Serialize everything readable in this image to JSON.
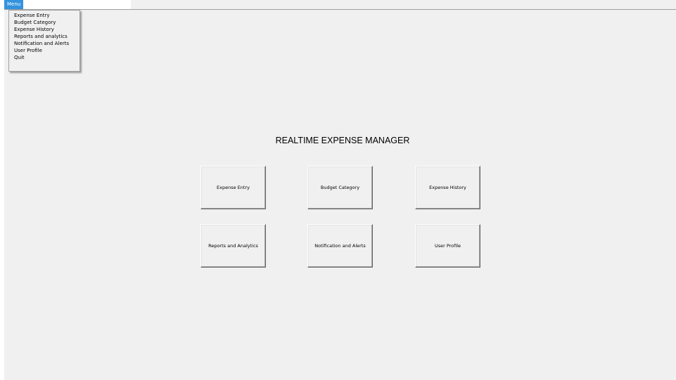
{
  "menubar": {
    "menu_label": "Menu"
  },
  "menu": {
    "items": [
      "Expense Entry",
      "Budget Category",
      "Expense History",
      "Reports and analytics",
      "Notification and Alerts",
      "User Profile",
      "Quit"
    ]
  },
  "main": {
    "title": "REALTIME EXPENSE MANAGER",
    "buttons": [
      "Expense Entry",
      "Budget Category",
      "Expense History",
      "Reports and Analytics",
      "Notification and Alerts",
      "User Profile"
    ]
  },
  "colors": {
    "window_background": "#f0f0f0",
    "menu_highlight": "#3393df"
  }
}
